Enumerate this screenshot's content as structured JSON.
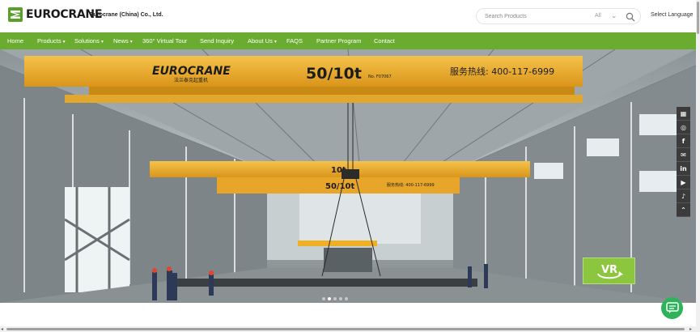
{
  "header": {
    "logo_text": "EUROCRANE",
    "company_name": "Eurocrane (China) Co., Ltd.",
    "search_placeholder": "Search Products",
    "search_category": "All",
    "language_label": "Select Language"
  },
  "nav": {
    "items": [
      {
        "label": "Home",
        "has_dropdown": false
      },
      {
        "label": "Products",
        "has_dropdown": true
      },
      {
        "label": "Solutions",
        "has_dropdown": true
      },
      {
        "label": "News",
        "has_dropdown": true
      },
      {
        "label": "360° Virtual Tour",
        "has_dropdown": false
      },
      {
        "label": "Send Inquiry",
        "has_dropdown": false
      },
      {
        "label": "About Us",
        "has_dropdown": true
      },
      {
        "label": "FAQS",
        "has_dropdown": false
      },
      {
        "label": "Partner Program",
        "has_dropdown": false
      },
      {
        "label": "Contact",
        "has_dropdown": false
      }
    ],
    "caret": "▾"
  },
  "hero": {
    "crane_brand": "EUROCRANE",
    "crane_sub": "法兰泰克起重机",
    "capacity_main": "50/10t",
    "capacity_code": "No. F07067",
    "hotline": "服务热线: 400-117-6999",
    "capacity_mid": "10t",
    "capacity_far": "50/10t",
    "hotline_far": "服务热线: 400-117-6999",
    "vr_label": "VR",
    "slide_count": 5,
    "active_slide": 1
  },
  "side_bar": [
    {
      "icon": "qr-code-icon",
      "glyph": "▦"
    },
    {
      "icon": "whatsapp-icon",
      "glyph": "◎"
    },
    {
      "icon": "facebook-icon",
      "glyph": "f"
    },
    {
      "icon": "email-icon",
      "glyph": "✉"
    },
    {
      "icon": "linkedin-icon",
      "glyph": "in"
    },
    {
      "icon": "youtube-icon",
      "glyph": "▶"
    },
    {
      "icon": "tiktok-icon",
      "glyph": "♪"
    },
    {
      "icon": "chevron-up-icon",
      "glyph": "⌃"
    }
  ],
  "colors": {
    "brand_green": "#6aac2f",
    "crane_yellow": "#f0b023",
    "chat_green": "#2fb35a"
  }
}
